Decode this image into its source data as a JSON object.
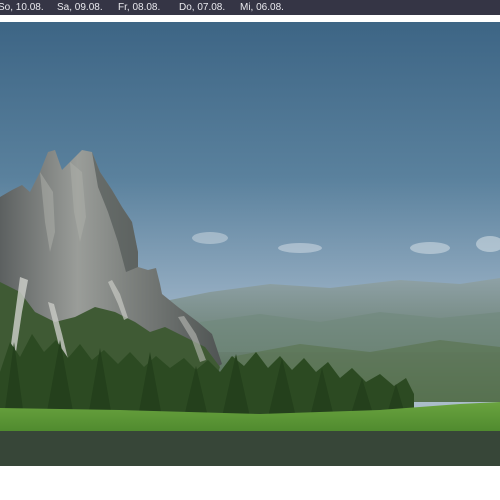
{
  "date_tabs": [
    {
      "label": "So, 10.08."
    },
    {
      "label": "Sa, 09.08."
    },
    {
      "label": "Fr, 08.08."
    },
    {
      "label": "Do, 07.08."
    },
    {
      "label": "Mi, 06.08."
    }
  ],
  "colors": {
    "bar_bg": "#353545",
    "bar_text": "#e9e9ee",
    "sky_top": "#3f6786",
    "sky_horizon": "#b4c7d6",
    "meadow": "#5f9a38",
    "lower_band": "#374638"
  },
  "webcam": {
    "scene": "mountain-peak-view"
  }
}
